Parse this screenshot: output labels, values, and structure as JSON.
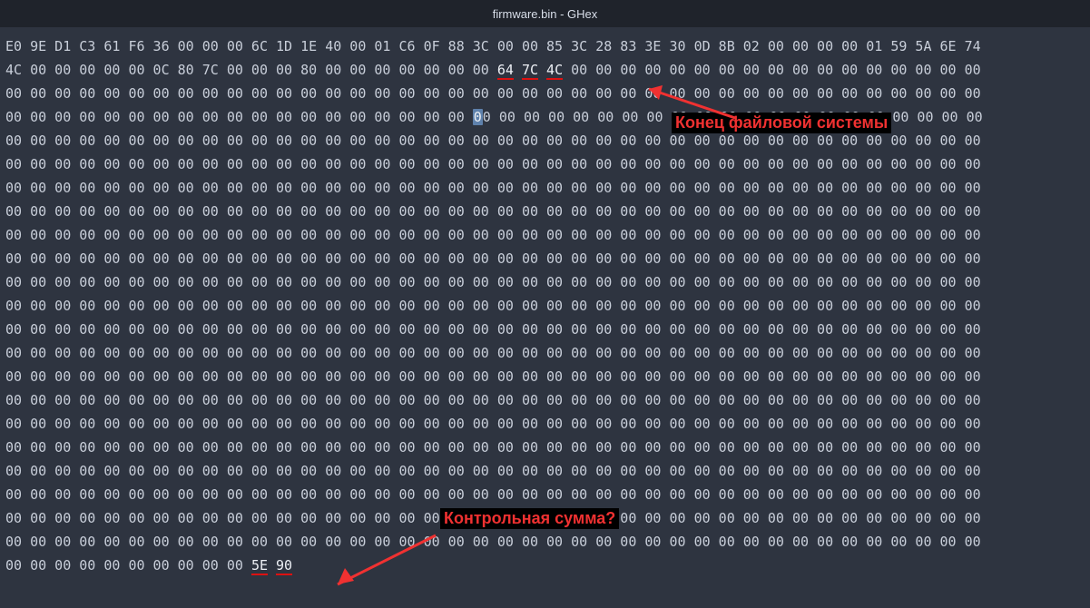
{
  "window": {
    "title": "firmware.bin - GHex"
  },
  "annotations": {
    "filesystem_end": "Конец файловой системы",
    "checksum": "Контрольная сумма?"
  },
  "hex": {
    "cols": 40,
    "cursor": {
      "row": 3,
      "col": 19
    },
    "highlight_fs": {
      "row": 1,
      "from": 20,
      "to": 22
    },
    "highlight_cs": {
      "row": 22,
      "from": 10,
      "to": 11
    },
    "rows": [
      [
        "E0",
        "9E",
        "D1",
        "C3",
        "61",
        "F6",
        "36",
        "00",
        "00",
        "00",
        "6C",
        "1D",
        "1E",
        "40",
        "00",
        "01",
        "C6",
        "0F",
        "88",
        "3C",
        "00",
        "00",
        "85",
        "3C",
        "28",
        "83",
        "3E",
        "30",
        "0D",
        "8B",
        "02",
        "00",
        "00",
        "00",
        "00",
        "01",
        "59",
        "5A",
        "6E",
        "74"
      ],
      [
        "4C",
        "00",
        "00",
        "00",
        "00",
        "00",
        "0C",
        "80",
        "7C",
        "00",
        "00",
        "00",
        "80",
        "00",
        "00",
        "00",
        "00",
        "00",
        "00",
        "00",
        "64",
        "7C",
        "4C",
        "00",
        "00",
        "00",
        "00",
        "00",
        "00",
        "00",
        "00",
        "00",
        "00",
        "00",
        "00",
        "00",
        "00",
        "00",
        "00",
        "00"
      ],
      [
        "00",
        "00",
        "00",
        "00",
        "00",
        "00",
        "00",
        "00",
        "00",
        "00",
        "00",
        "00",
        "00",
        "00",
        "00",
        "00",
        "00",
        "00",
        "00",
        "00",
        "00",
        "00",
        "00",
        "00",
        "00",
        "00",
        "00",
        "00",
        "00",
        "00",
        "00",
        "00",
        "00",
        "00",
        "00",
        "00",
        "00",
        "00",
        "00",
        "00"
      ],
      [
        "00",
        "00",
        "00",
        "00",
        "00",
        "00",
        "00",
        "00",
        "00",
        "00",
        "00",
        "00",
        "00",
        "00",
        "00",
        "00",
        "00",
        "00",
        "00",
        "00",
        "00",
        "00",
        "00",
        "00",
        "00",
        "00",
        "00",
        "00",
        "00",
        "00",
        "00",
        "00",
        "00",
        "00",
        "00",
        "00",
        "00",
        "00",
        "00",
        "00"
      ],
      [
        "00",
        "00",
        "00",
        "00",
        "00",
        "00",
        "00",
        "00",
        "00",
        "00",
        "00",
        "00",
        "00",
        "00",
        "00",
        "00",
        "00",
        "00",
        "00",
        "00",
        "00",
        "00",
        "00",
        "00",
        "00",
        "00",
        "00",
        "00",
        "00",
        "00",
        "00",
        "00",
        "00",
        "00",
        "00",
        "00",
        "00",
        "00",
        "00",
        "00"
      ],
      [
        "00",
        "00",
        "00",
        "00",
        "00",
        "00",
        "00",
        "00",
        "00",
        "00",
        "00",
        "00",
        "00",
        "00",
        "00",
        "00",
        "00",
        "00",
        "00",
        "00",
        "00",
        "00",
        "00",
        "00",
        "00",
        "00",
        "00",
        "00",
        "00",
        "00",
        "00",
        "00",
        "00",
        "00",
        "00",
        "00",
        "00",
        "00",
        "00",
        "00"
      ],
      [
        "00",
        "00",
        "00",
        "00",
        "00",
        "00",
        "00",
        "00",
        "00",
        "00",
        "00",
        "00",
        "00",
        "00",
        "00",
        "00",
        "00",
        "00",
        "00",
        "00",
        "00",
        "00",
        "00",
        "00",
        "00",
        "00",
        "00",
        "00",
        "00",
        "00",
        "00",
        "00",
        "00",
        "00",
        "00",
        "00",
        "00",
        "00",
        "00",
        "00"
      ],
      [
        "00",
        "00",
        "00",
        "00",
        "00",
        "00",
        "00",
        "00",
        "00",
        "00",
        "00",
        "00",
        "00",
        "00",
        "00",
        "00",
        "00",
        "00",
        "00",
        "00",
        "00",
        "00",
        "00",
        "00",
        "00",
        "00",
        "00",
        "00",
        "00",
        "00",
        "00",
        "00",
        "00",
        "00",
        "00",
        "00",
        "00",
        "00",
        "00",
        "00"
      ],
      [
        "00",
        "00",
        "00",
        "00",
        "00",
        "00",
        "00",
        "00",
        "00",
        "00",
        "00",
        "00",
        "00",
        "00",
        "00",
        "00",
        "00",
        "00",
        "00",
        "00",
        "00",
        "00",
        "00",
        "00",
        "00",
        "00",
        "00",
        "00",
        "00",
        "00",
        "00",
        "00",
        "00",
        "00",
        "00",
        "00",
        "00",
        "00",
        "00",
        "00"
      ],
      [
        "00",
        "00",
        "00",
        "00",
        "00",
        "00",
        "00",
        "00",
        "00",
        "00",
        "00",
        "00",
        "00",
        "00",
        "00",
        "00",
        "00",
        "00",
        "00",
        "00",
        "00",
        "00",
        "00",
        "00",
        "00",
        "00",
        "00",
        "00",
        "00",
        "00",
        "00",
        "00",
        "00",
        "00",
        "00",
        "00",
        "00",
        "00",
        "00",
        "00"
      ],
      [
        "00",
        "00",
        "00",
        "00",
        "00",
        "00",
        "00",
        "00",
        "00",
        "00",
        "00",
        "00",
        "00",
        "00",
        "00",
        "00",
        "00",
        "00",
        "00",
        "00",
        "00",
        "00",
        "00",
        "00",
        "00",
        "00",
        "00",
        "00",
        "00",
        "00",
        "00",
        "00",
        "00",
        "00",
        "00",
        "00",
        "00",
        "00",
        "00",
        "00"
      ],
      [
        "00",
        "00",
        "00",
        "00",
        "00",
        "00",
        "00",
        "00",
        "00",
        "00",
        "00",
        "00",
        "00",
        "00",
        "00",
        "00",
        "00",
        "00",
        "00",
        "00",
        "00",
        "00",
        "00",
        "00",
        "00",
        "00",
        "00",
        "00",
        "00",
        "00",
        "00",
        "00",
        "00",
        "00",
        "00",
        "00",
        "00",
        "00",
        "00",
        "00"
      ],
      [
        "00",
        "00",
        "00",
        "00",
        "00",
        "00",
        "00",
        "00",
        "00",
        "00",
        "00",
        "00",
        "00",
        "00",
        "00",
        "00",
        "00",
        "00",
        "00",
        "00",
        "00",
        "00",
        "00",
        "00",
        "00",
        "00",
        "00",
        "00",
        "00",
        "00",
        "00",
        "00",
        "00",
        "00",
        "00",
        "00",
        "00",
        "00",
        "00",
        "00"
      ],
      [
        "00",
        "00",
        "00",
        "00",
        "00",
        "00",
        "00",
        "00",
        "00",
        "00",
        "00",
        "00",
        "00",
        "00",
        "00",
        "00",
        "00",
        "00",
        "00",
        "00",
        "00",
        "00",
        "00",
        "00",
        "00",
        "00",
        "00",
        "00",
        "00",
        "00",
        "00",
        "00",
        "00",
        "00",
        "00",
        "00",
        "00",
        "00",
        "00",
        "00"
      ],
      [
        "00",
        "00",
        "00",
        "00",
        "00",
        "00",
        "00",
        "00",
        "00",
        "00",
        "00",
        "00",
        "00",
        "00",
        "00",
        "00",
        "00",
        "00",
        "00",
        "00",
        "00",
        "00",
        "00",
        "00",
        "00",
        "00",
        "00",
        "00",
        "00",
        "00",
        "00",
        "00",
        "00",
        "00",
        "00",
        "00",
        "00",
        "00",
        "00",
        "00"
      ],
      [
        "00",
        "00",
        "00",
        "00",
        "00",
        "00",
        "00",
        "00",
        "00",
        "00",
        "00",
        "00",
        "00",
        "00",
        "00",
        "00",
        "00",
        "00",
        "00",
        "00",
        "00",
        "00",
        "00",
        "00",
        "00",
        "00",
        "00",
        "00",
        "00",
        "00",
        "00",
        "00",
        "00",
        "00",
        "00",
        "00",
        "00",
        "00",
        "00",
        "00"
      ],
      [
        "00",
        "00",
        "00",
        "00",
        "00",
        "00",
        "00",
        "00",
        "00",
        "00",
        "00",
        "00",
        "00",
        "00",
        "00",
        "00",
        "00",
        "00",
        "00",
        "00",
        "00",
        "00",
        "00",
        "00",
        "00",
        "00",
        "00",
        "00",
        "00",
        "00",
        "00",
        "00",
        "00",
        "00",
        "00",
        "00",
        "00",
        "00",
        "00",
        "00"
      ],
      [
        "00",
        "00",
        "00",
        "00",
        "00",
        "00",
        "00",
        "00",
        "00",
        "00",
        "00",
        "00",
        "00",
        "00",
        "00",
        "00",
        "00",
        "00",
        "00",
        "00",
        "00",
        "00",
        "00",
        "00",
        "00",
        "00",
        "00",
        "00",
        "00",
        "00",
        "00",
        "00",
        "00",
        "00",
        "00",
        "00",
        "00",
        "00",
        "00",
        "00"
      ],
      [
        "00",
        "00",
        "00",
        "00",
        "00",
        "00",
        "00",
        "00",
        "00",
        "00",
        "00",
        "00",
        "00",
        "00",
        "00",
        "00",
        "00",
        "00",
        "00",
        "00",
        "00",
        "00",
        "00",
        "00",
        "00",
        "00",
        "00",
        "00",
        "00",
        "00",
        "00",
        "00",
        "00",
        "00",
        "00",
        "00",
        "00",
        "00",
        "00",
        "00"
      ],
      [
        "00",
        "00",
        "00",
        "00",
        "00",
        "00",
        "00",
        "00",
        "00",
        "00",
        "00",
        "00",
        "00",
        "00",
        "00",
        "00",
        "00",
        "00",
        "00",
        "00",
        "00",
        "00",
        "00",
        "00",
        "00",
        "00",
        "00",
        "00",
        "00",
        "00",
        "00",
        "00",
        "00",
        "00",
        "00",
        "00",
        "00",
        "00",
        "00",
        "00"
      ],
      [
        "00",
        "00",
        "00",
        "00",
        "00",
        "00",
        "00",
        "00",
        "00",
        "00",
        "00",
        "00",
        "00",
        "00",
        "00",
        "00",
        "00",
        "00",
        "00",
        "00",
        "00",
        "00",
        "00",
        "00",
        "00",
        "00",
        "00",
        "00",
        "00",
        "00",
        "00",
        "00",
        "00",
        "00",
        "00",
        "00",
        "00",
        "00",
        "00",
        "00"
      ],
      [
        "00",
        "00",
        "00",
        "00",
        "00",
        "00",
        "00",
        "00",
        "00",
        "00",
        "00",
        "00",
        "00",
        "00",
        "00",
        "00",
        "00",
        "00",
        "00",
        "00",
        "00",
        "00",
        "00",
        "00",
        "00",
        "00",
        "00",
        "00",
        "00",
        "00",
        "00",
        "00",
        "00",
        "00",
        "00",
        "00",
        "00",
        "00",
        "00",
        "00"
      ],
      [
        "00",
        "00",
        "00",
        "00",
        "00",
        "00",
        "00",
        "00",
        "00",
        "00",
        "5E",
        "90"
      ]
    ]
  }
}
